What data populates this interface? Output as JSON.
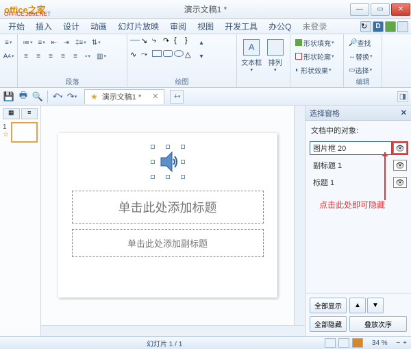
{
  "titlebar": {
    "logo": "office之家",
    "logo_sub": "OFFICE.JB51.NET",
    "title": "演示文稿1 *"
  },
  "menu": {
    "items": [
      "开始",
      "插入",
      "设计",
      "动画",
      "幻灯片放映",
      "审阅",
      "视图",
      "开发工具",
      "办公Q"
    ],
    "login": "未登录"
  },
  "ribbon": {
    "group_paragraph": "段落",
    "group_drawing": "绘图",
    "group_edit": "编辑",
    "textbox": "文本框",
    "arrange": "排列",
    "shape_fill": "形状填充",
    "shape_outline": "形状轮廓",
    "shape_effect": "形状效果",
    "find": "查找",
    "replace": "替换",
    "select": "选择"
  },
  "qat": {
    "doc_name": "演示文稿1 *"
  },
  "slide": {
    "title_ph": "单击此处添加标题",
    "subtitle_ph": "单击此处添加副标题"
  },
  "selpane": {
    "title": "选择窗格",
    "label": "文档中的对象:",
    "items": [
      {
        "name": "图片框 20",
        "selected": true
      },
      {
        "name": "副标题 1",
        "selected": false
      },
      {
        "name": "标题 1",
        "selected": false
      }
    ],
    "callout": "点击此处即可隐藏",
    "show_all": "全部显示",
    "hide_all": "全部隐藏",
    "order": "叠放次序"
  },
  "status": {
    "slide": "幻灯片 1 / 1",
    "zoom": "34 %"
  },
  "thumb": {
    "num": "1"
  }
}
